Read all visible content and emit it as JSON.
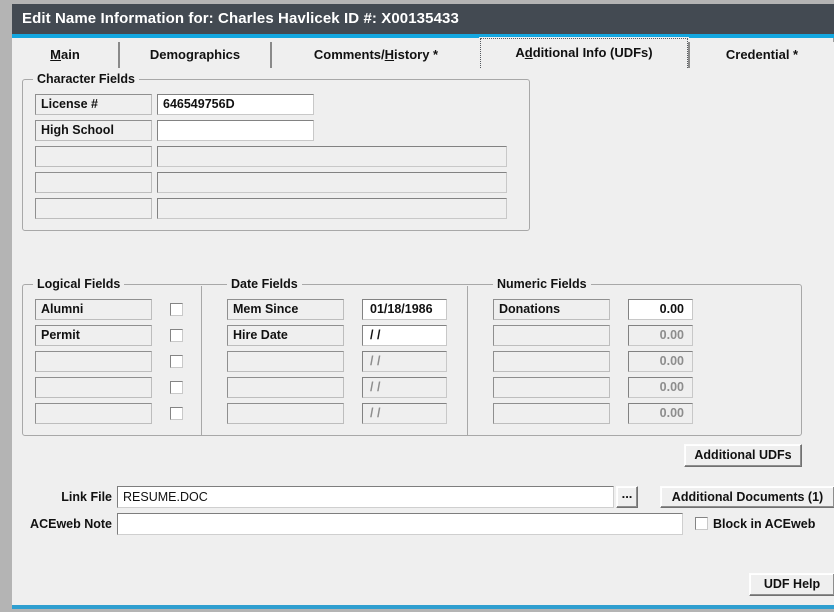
{
  "window": {
    "title": "Edit Name Information for: Charles Havlicek ID #: X00135433",
    "accent_color": "#13a7e0",
    "titlebar_color": "#434a52"
  },
  "tabs": [
    {
      "label": "Main",
      "accesskey": "M",
      "active": false
    },
    {
      "label": "Demographics",
      "accesskey": "",
      "active": false
    },
    {
      "label": "Comments/History *",
      "accesskey": "H",
      "active": false
    },
    {
      "label": "Additional Info (UDFs)",
      "accesskey": "d",
      "active": true
    },
    {
      "label": "Credential *",
      "accesskey": "",
      "active": false
    }
  ],
  "character_fields": {
    "legend": "Character Fields",
    "rows": [
      {
        "label": "License #",
        "value": "646549756D",
        "disabled": false
      },
      {
        "label": "High School",
        "value": "",
        "disabled": false
      },
      {
        "label": "",
        "value": "",
        "disabled": true
      },
      {
        "label": "",
        "value": "",
        "disabled": true
      },
      {
        "label": "",
        "value": "",
        "disabled": true
      }
    ]
  },
  "logical_fields": {
    "legend": "Logical Fields",
    "rows": [
      {
        "label": "Alumni",
        "checked": false,
        "disabled": false
      },
      {
        "label": "Permit",
        "checked": false,
        "disabled": false
      },
      {
        "label": "",
        "checked": false,
        "disabled": true
      },
      {
        "label": "",
        "checked": false,
        "disabled": true
      },
      {
        "label": "",
        "checked": false,
        "disabled": true
      }
    ]
  },
  "date_fields": {
    "legend": "Date Fields",
    "rows": [
      {
        "label": "Mem Since",
        "value": "01/18/1986",
        "disabled": false
      },
      {
        "label": "Hire Date",
        "value": "/  /",
        "disabled": false
      },
      {
        "label": "",
        "value": "/  /",
        "disabled": true
      },
      {
        "label": "",
        "value": "/  /",
        "disabled": true
      },
      {
        "label": "",
        "value": "/  /",
        "disabled": true
      }
    ]
  },
  "numeric_fields": {
    "legend": "Numeric Fields",
    "rows": [
      {
        "label": "Donations",
        "value": "0.00",
        "disabled": false
      },
      {
        "label": "",
        "value": "0.00",
        "disabled": true
      },
      {
        "label": "",
        "value": "0.00",
        "disabled": true
      },
      {
        "label": "",
        "value": "0.00",
        "disabled": true
      },
      {
        "label": "",
        "value": "0.00",
        "disabled": true
      }
    ]
  },
  "bottom": {
    "additional_udfs_label": "Additional UDFs",
    "link_file_label": "Link File",
    "link_file_value": "RESUME.DOC",
    "browse_label": "...",
    "additional_documents_label": "Additional Documents (1)",
    "aceweb_note_label": "ACEweb Note",
    "aceweb_note_value": "",
    "block_in_aceweb_label": "Block in ACEweb",
    "block_in_aceweb_checked": false,
    "udf_help_label": "UDF Help"
  }
}
